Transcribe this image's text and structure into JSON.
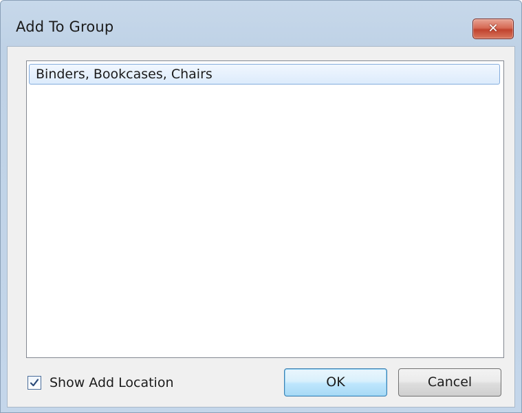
{
  "dialog": {
    "title": "Add To Group",
    "close_icon": "close-icon",
    "list": {
      "items": [
        {
          "label": "Binders, Bookcases, Chairs",
          "selected": true
        }
      ]
    },
    "show_add_location": {
      "label": "Show Add Location",
      "checked": true
    },
    "buttons": {
      "ok_label": "OK",
      "cancel_label": "Cancel"
    },
    "colors": {
      "accent": "#3c7fb1",
      "close_button": "#c0432f",
      "selection": "#dcebfc"
    }
  }
}
